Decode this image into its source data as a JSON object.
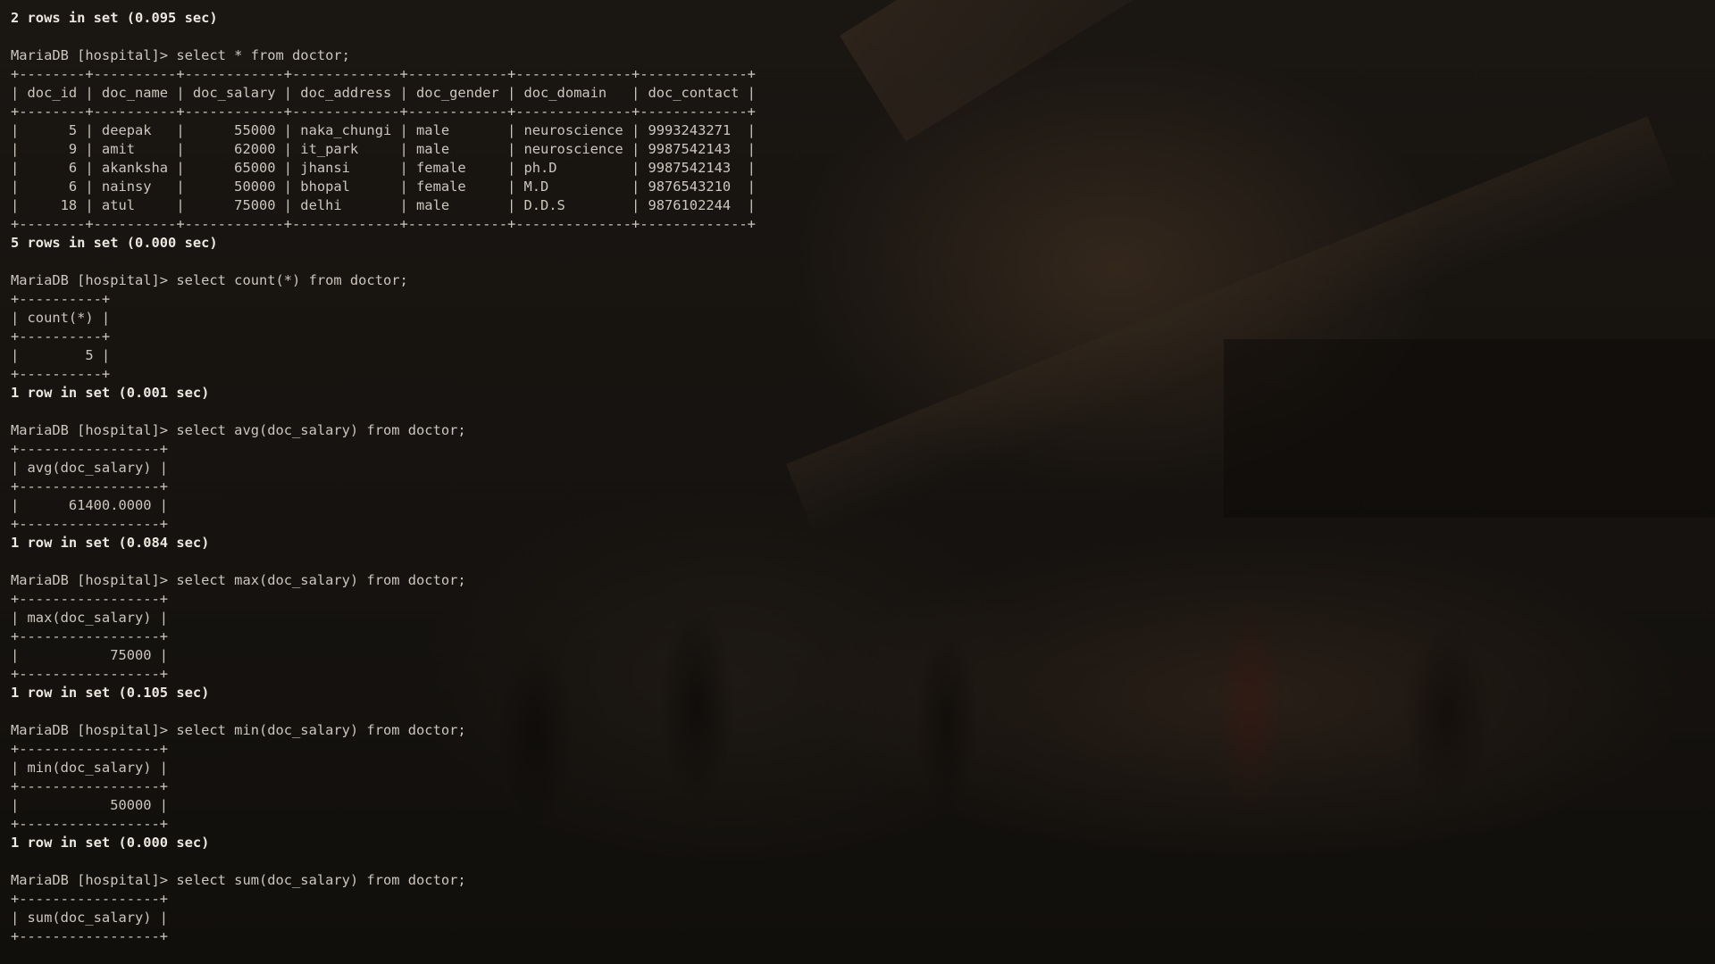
{
  "terminal": {
    "lines": [
      {
        "text": "2 rows in set (0.095 sec)",
        "kind": "status"
      },
      {
        "text": "",
        "kind": "blank"
      },
      {
        "text": "MariaDB [hospital]> select * from doctor;",
        "kind": "command"
      },
      {
        "text": "+--------+----------+------------+-------------+------------+--------------+-------------+",
        "kind": "border"
      },
      {
        "text": "| doc_id | doc_name | doc_salary | doc_address | doc_gender | doc_domain   | doc_contact |",
        "kind": "header"
      },
      {
        "text": "+--------+----------+------------+-------------+------------+--------------+-------------+",
        "kind": "border"
      },
      {
        "text": "|      5 | deepak   |      55000 | naka_chungi | male       | neuroscience | 9993243271  |",
        "kind": "row"
      },
      {
        "text": "|      9 | amit     |      62000 | it_park     | male       | neuroscience | 9987542143  |",
        "kind": "row"
      },
      {
        "text": "|      6 | akanksha |      65000 | jhansi      | female     | ph.D         | 9987542143  |",
        "kind": "row"
      },
      {
        "text": "|      6 | nainsy   |      50000 | bhopal      | female     | M.D          | 9876543210  |",
        "kind": "row"
      },
      {
        "text": "|     18 | atul     |      75000 | delhi       | male       | D.D.S        | 9876102244  |",
        "kind": "row"
      },
      {
        "text": "+--------+----------+------------+-------------+------------+--------------+-------------+",
        "kind": "border"
      },
      {
        "text": "5 rows in set (0.000 sec)",
        "kind": "status"
      },
      {
        "text": "",
        "kind": "blank"
      },
      {
        "text": "MariaDB [hospital]> select count(*) from doctor;",
        "kind": "command"
      },
      {
        "text": "+----------+",
        "kind": "border"
      },
      {
        "text": "| count(*) |",
        "kind": "header"
      },
      {
        "text": "+----------+",
        "kind": "border"
      },
      {
        "text": "|        5 |",
        "kind": "row"
      },
      {
        "text": "+----------+",
        "kind": "border"
      },
      {
        "text": "1 row in set (0.001 sec)",
        "kind": "status"
      },
      {
        "text": "",
        "kind": "blank"
      },
      {
        "text": "MariaDB [hospital]> select avg(doc_salary) from doctor;",
        "kind": "command"
      },
      {
        "text": "+-----------------+",
        "kind": "border"
      },
      {
        "text": "| avg(doc_salary) |",
        "kind": "header"
      },
      {
        "text": "+-----------------+",
        "kind": "border"
      },
      {
        "text": "|      61400.0000 |",
        "kind": "row"
      },
      {
        "text": "+-----------------+",
        "kind": "border"
      },
      {
        "text": "1 row in set (0.084 sec)",
        "kind": "status"
      },
      {
        "text": "",
        "kind": "blank"
      },
      {
        "text": "MariaDB [hospital]> select max(doc_salary) from doctor;",
        "kind": "command"
      },
      {
        "text": "+-----------------+",
        "kind": "border"
      },
      {
        "text": "| max(doc_salary) |",
        "kind": "header"
      },
      {
        "text": "+-----------------+",
        "kind": "border"
      },
      {
        "text": "|           75000 |",
        "kind": "row"
      },
      {
        "text": "+-----------------+",
        "kind": "border"
      },
      {
        "text": "1 row in set (0.105 sec)",
        "kind": "status"
      },
      {
        "text": "",
        "kind": "blank"
      },
      {
        "text": "MariaDB [hospital]> select min(doc_salary) from doctor;",
        "kind": "command"
      },
      {
        "text": "+-----------------+",
        "kind": "border"
      },
      {
        "text": "| min(doc_salary) |",
        "kind": "header"
      },
      {
        "text": "+-----------------+",
        "kind": "border"
      },
      {
        "text": "|           50000 |",
        "kind": "row"
      },
      {
        "text": "+-----------------+",
        "kind": "border"
      },
      {
        "text": "1 row in set (0.000 sec)",
        "kind": "status"
      },
      {
        "text": "",
        "kind": "blank"
      },
      {
        "text": "MariaDB [hospital]> select sum(doc_salary) from doctor;",
        "kind": "command"
      },
      {
        "text": "+-----------------+",
        "kind": "border"
      },
      {
        "text": "| sum(doc_salary) |",
        "kind": "header"
      },
      {
        "text": "+-----------------+",
        "kind": "border"
      }
    ]
  }
}
